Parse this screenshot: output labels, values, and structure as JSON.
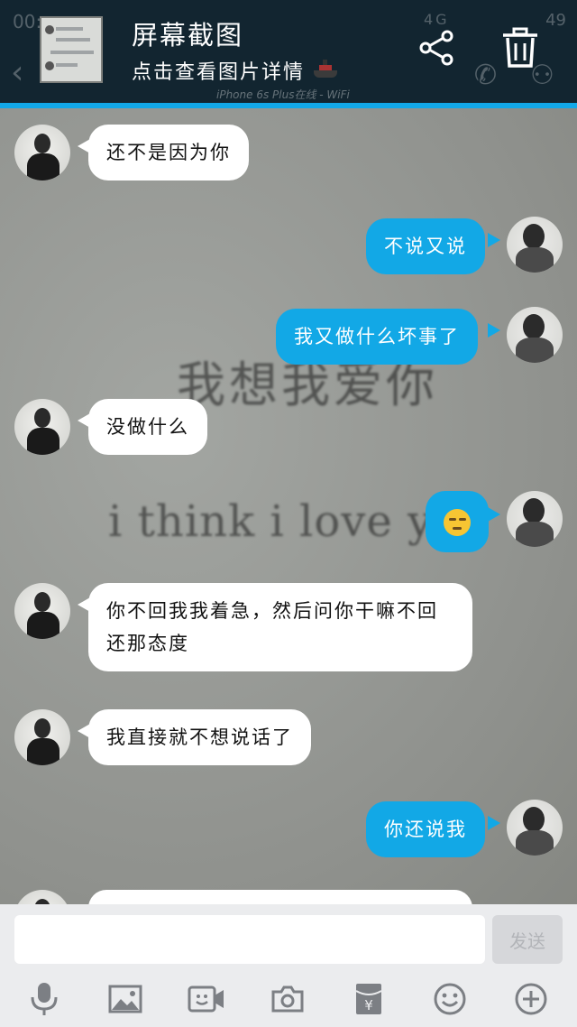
{
  "header": {
    "title": "屏幕截图",
    "subtitle": "点击查看图片详情",
    "ghost_time": "00:",
    "ghost_battery": "49",
    "ghost_signal": "4G",
    "ghost_subline": "iPhone 6s Plus在线 - WiFi",
    "share_icon": "share-icon",
    "delete_icon": "trash-icon"
  },
  "background": {
    "chinese_text": "我想我爱你",
    "english_text": "i think i love you"
  },
  "messages": [
    {
      "side": "in",
      "text": "还不是因为你"
    },
    {
      "side": "out",
      "text": "不说又说"
    },
    {
      "side": "out",
      "text": "我又做什么坏事了"
    },
    {
      "side": "in",
      "text": "没做什么"
    },
    {
      "side": "out",
      "text": "",
      "emoji": "unamused-face"
    },
    {
      "side": "in",
      "text": "你不回我我着急，然后问你干嘛不回还那态度"
    },
    {
      "side": "in",
      "text": "我直接就不想说话了"
    },
    {
      "side": "out",
      "text": "你还说我"
    }
  ],
  "input": {
    "placeholder": "",
    "value": "",
    "send_label": "发送"
  },
  "toolbar": [
    {
      "icon": "microphone-icon"
    },
    {
      "icon": "image-icon"
    },
    {
      "icon": "video-call-icon"
    },
    {
      "icon": "camera-icon"
    },
    {
      "icon": "red-packet-icon"
    },
    {
      "icon": "emoji-icon"
    },
    {
      "icon": "plus-icon"
    }
  ],
  "colors": {
    "header_bg": "#122530",
    "accent_blue": "#12a8e6",
    "incoming_bubble": "#ffffff"
  }
}
